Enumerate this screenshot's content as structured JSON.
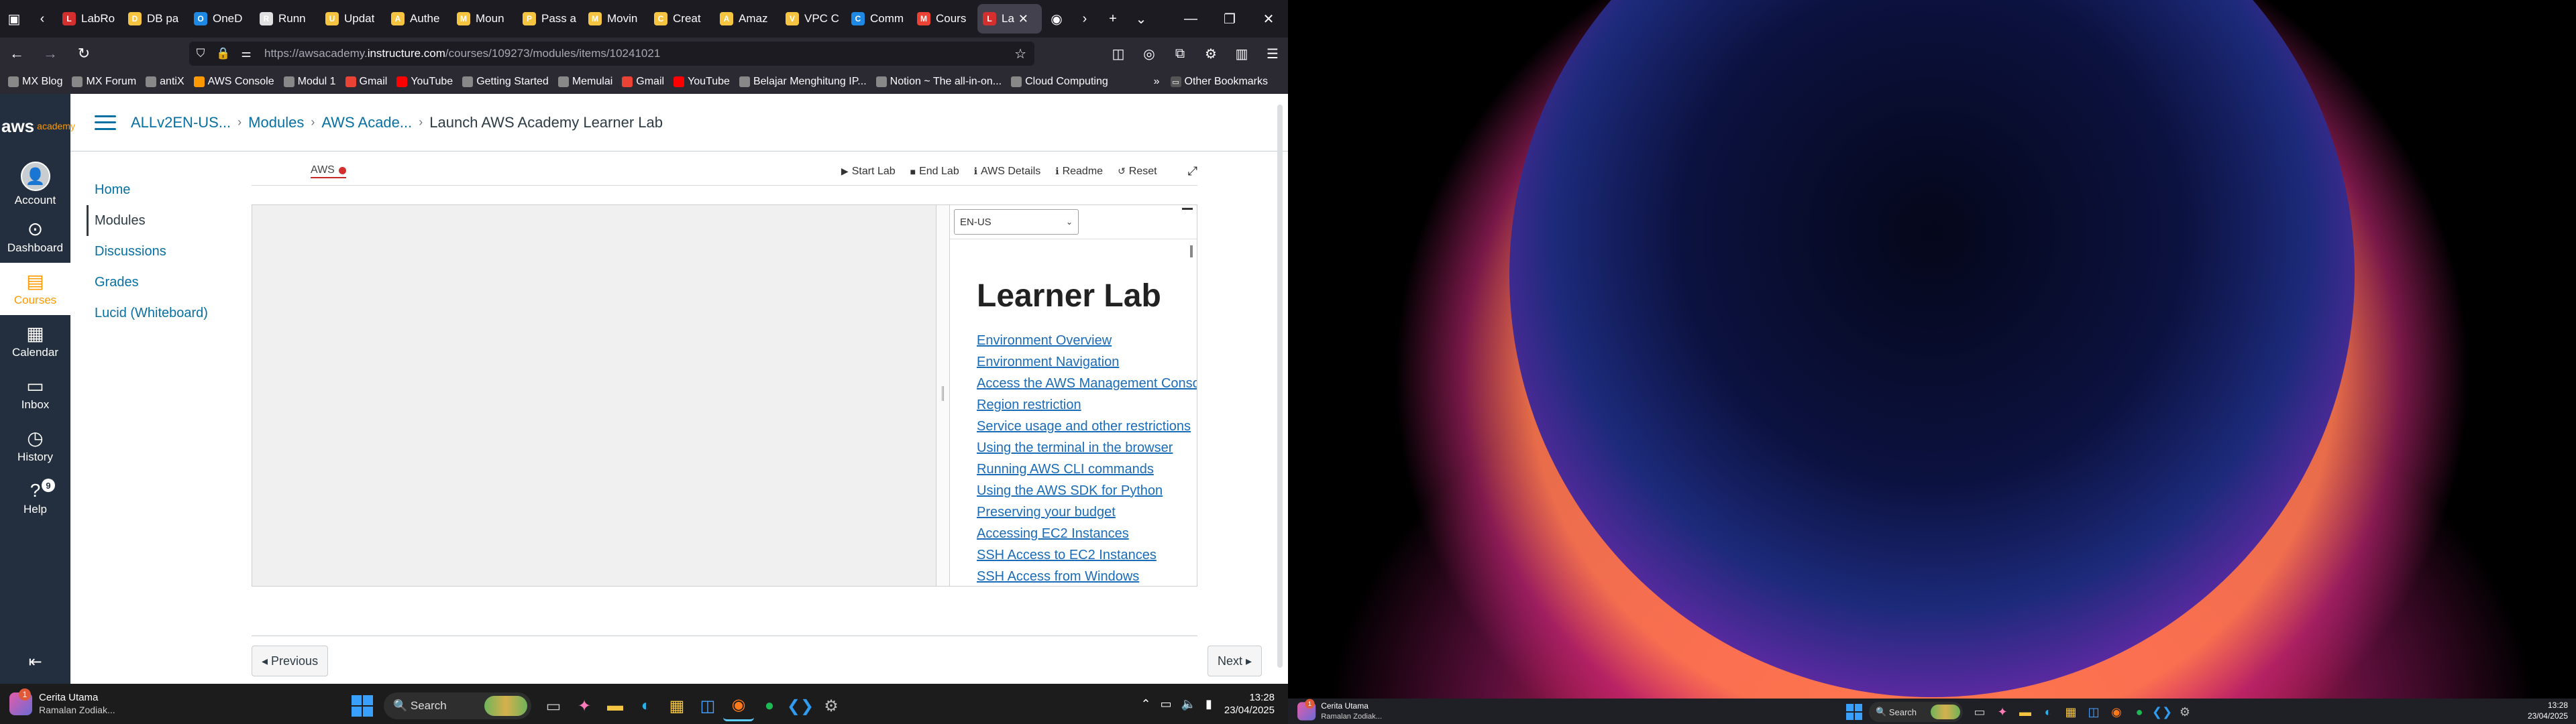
{
  "browser": {
    "tabs": [
      {
        "label": "LabRo",
        "color": "#d32f2f",
        "glyph": "L"
      },
      {
        "label": "DB pa",
        "color": "#f5c542",
        "glyph": "D"
      },
      {
        "label": "OneD",
        "color": "#1e88e5",
        "glyph": "O"
      },
      {
        "label": "Runn",
        "color": "#e0e0e0",
        "glyph": "R"
      },
      {
        "label": "Updat",
        "color": "#f5c542",
        "glyph": "U"
      },
      {
        "label": "Authe",
        "color": "#f5c542",
        "glyph": "A"
      },
      {
        "label": "Moun",
        "color": "#f5c542",
        "glyph": "M"
      },
      {
        "label": "Pass a",
        "color": "#f5c542",
        "glyph": "P"
      },
      {
        "label": "Movin",
        "color": "#f5c542",
        "glyph": "M"
      },
      {
        "label": "Creat",
        "color": "#f5c542",
        "glyph": "C"
      },
      {
        "label": "Amaz",
        "color": "#f5c542",
        "glyph": "A"
      },
      {
        "label": "VPC C",
        "color": "#f5c542",
        "glyph": "V"
      },
      {
        "label": "Comm",
        "color": "#1e88e5",
        "glyph": "C"
      },
      {
        "label": "Cours",
        "color": "#ea4335",
        "glyph": "M"
      },
      {
        "label": "La",
        "color": "#d32f2f",
        "glyph": "L",
        "active": true
      }
    ],
    "url_prefix": "https://awsacademy.",
    "url_host": "instructure.com",
    "url_path": "/courses/109273/modules/items/10241021",
    "bookmarks": [
      {
        "label": "MX Blog",
        "color": "#888"
      },
      {
        "label": "MX Forum",
        "color": "#888"
      },
      {
        "label": "antiX",
        "color": "#888"
      },
      {
        "label": "AWS Console",
        "color": "#ff9900"
      },
      {
        "label": "Modul 1",
        "color": "#888"
      },
      {
        "label": "Gmail",
        "color": "#ea4335"
      },
      {
        "label": "YouTube",
        "color": "#ff0000"
      },
      {
        "label": "Getting Started",
        "color": "#888"
      },
      {
        "label": "Memulai",
        "color": "#888"
      },
      {
        "label": "Gmail",
        "color": "#ea4335"
      },
      {
        "label": "YouTube",
        "color": "#ff0000"
      },
      {
        "label": "Belajar Menghitung IP...",
        "color": "#888"
      },
      {
        "label": "Notion ~ The all-in-on...",
        "color": "#888"
      },
      {
        "label": "Cloud Computing",
        "color": "#888"
      }
    ],
    "other_bookmarks": "Other Bookmarks"
  },
  "canvas": {
    "logo_text": "aws",
    "logo_sub": "academy",
    "global_nav": [
      {
        "label": "Account",
        "icon": "account-icon",
        "glyph": "👤"
      },
      {
        "label": "Dashboard",
        "icon": "dashboard-icon",
        "glyph": "⊙"
      },
      {
        "label": "Courses",
        "icon": "courses-icon",
        "glyph": "▤",
        "active": true
      },
      {
        "label": "Calendar",
        "icon": "calendar-icon",
        "glyph": "▦"
      },
      {
        "label": "Inbox",
        "icon": "inbox-icon",
        "glyph": "▭"
      },
      {
        "label": "History",
        "icon": "history-icon",
        "glyph": "◷"
      },
      {
        "label": "Help",
        "icon": "help-icon",
        "glyph": "?",
        "badge": "9"
      }
    ],
    "breadcrumb": [
      "ALLv2EN-US...",
      "Modules",
      "AWS Acade...",
      "Launch AWS Academy Learner Lab"
    ],
    "course_nav": [
      {
        "label": "Home"
      },
      {
        "label": "Modules",
        "active": true
      },
      {
        "label": "Discussions"
      },
      {
        "label": "Grades"
      },
      {
        "label": "Lucid (Whiteboard)"
      }
    ],
    "lab": {
      "aws_status_label": "AWS",
      "aws_status_color": "#d32f2f",
      "toolbar": [
        {
          "label": "Start Lab",
          "glyph": "▶"
        },
        {
          "label": "End Lab",
          "glyph": "■"
        },
        {
          "label": "AWS Details",
          "glyph": "ℹ"
        },
        {
          "label": "Readme",
          "glyph": "ℹ"
        },
        {
          "label": "Reset",
          "glyph": "↺"
        }
      ],
      "language": "EN-US",
      "readme_title": "Learner Lab",
      "readme_links": [
        "Environment Overview",
        "Environment Navigation",
        "Access the AWS Management Console",
        "Region restriction",
        "Service usage and other restrictions",
        "Using the terminal in the browser",
        "Running AWS CLI commands",
        "Using the AWS SDK for Python",
        "Preserving your budget",
        "Accessing EC2 Instances",
        "SSH Access to EC2 Instances",
        "SSH Access from Windows"
      ]
    },
    "prev_label": "◂ Previous",
    "next_label": "Next ▸"
  },
  "taskbar": {
    "widget_title": "Cerita Utama",
    "widget_sub": "Ramalan Zodiak...",
    "widget_badge": "1",
    "search_label": "Search",
    "time": "13:28",
    "date": "23/04/2025"
  }
}
